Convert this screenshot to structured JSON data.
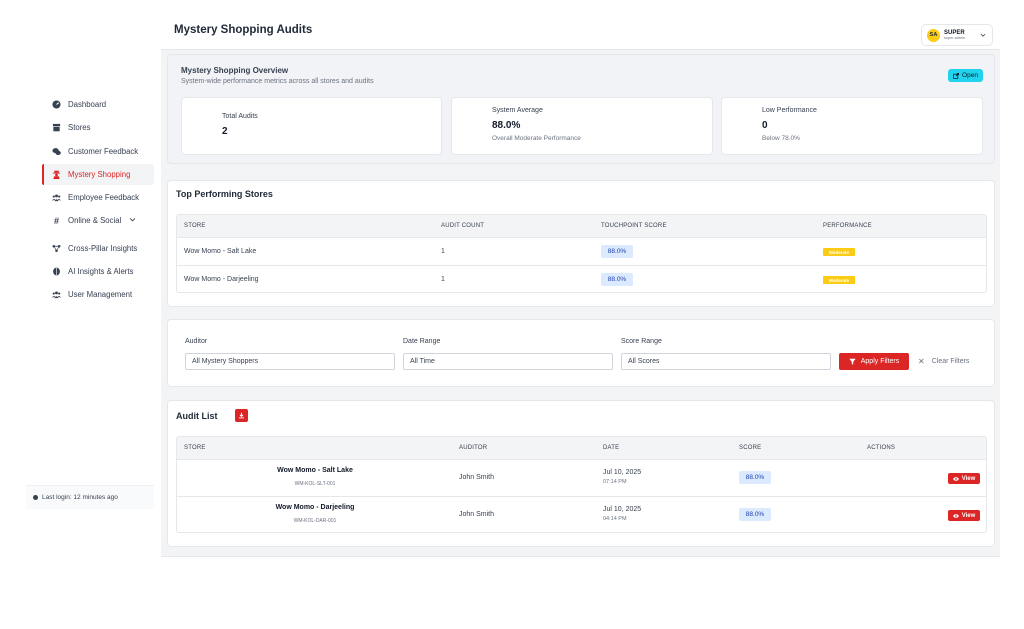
{
  "sidebar": {
    "items": [
      {
        "label": "Dashboard",
        "icon": "dashboard-icon"
      },
      {
        "label": "Stores",
        "icon": "store-icon"
      },
      {
        "label": "Customer Feedback",
        "icon": "chat-bubbles-icon"
      },
      {
        "label": "Mystery Shopping",
        "icon": "user-secret-icon",
        "active": true
      },
      {
        "label": "Employee Feedback",
        "icon": "users-icon"
      },
      {
        "label": "Online & Social",
        "icon": "hashtag-icon",
        "has_chevron": true
      },
      {
        "label": "Cross-Pillar Insights",
        "icon": "network-icon"
      },
      {
        "label": "AI Insights & Alerts",
        "icon": "brain-icon"
      },
      {
        "label": "User Management",
        "icon": "users-cog-icon"
      }
    ],
    "last_login": "Last login: 12 minutes ago"
  },
  "header": {
    "title": "Mystery Shopping Audits",
    "user": {
      "initials": "SA",
      "name": "SUPER",
      "role": "super-admin"
    }
  },
  "overview": {
    "title": "Mystery Shopping Overview",
    "subtitle": "System-wide performance metrics across all stores and audits",
    "open_label": "Open",
    "stats": [
      {
        "label": "Total Audits",
        "value": "2",
        "sub": ""
      },
      {
        "label": "System Average",
        "value": "88.0%",
        "sub": "Overall Moderate Performance"
      },
      {
        "label": "Low Performance",
        "value": "0",
        "sub": "Below 78.0%"
      }
    ]
  },
  "top_stores": {
    "title": "Top Performing Stores",
    "columns": [
      "STORE",
      "AUDIT COUNT",
      "TOUCHPOINT SCORE",
      "PERFORMANCE"
    ],
    "rows": [
      {
        "store": "Wow Momo - Salt Lake",
        "count": "1",
        "score": "88.0%",
        "performance": "Moderate"
      },
      {
        "store": "Wow Momo - Darjeeling",
        "count": "1",
        "score": "88.0%",
        "performance": "Moderate"
      }
    ]
  },
  "filters": {
    "auditor_label": "Auditor",
    "auditor_value": "All Mystery Shoppers",
    "date_label": "Date Range",
    "date_value": "All Time",
    "score_label": "Score Range",
    "score_value": "All Scores",
    "apply_label": "Apply Filters",
    "clear_label": "Clear Filters"
  },
  "audit_list": {
    "title": "Audit List",
    "columns": [
      "STORE",
      "AUDITOR",
      "DATE",
      "SCORE",
      "ACTIONS"
    ],
    "rows": [
      {
        "store": "Wow Momo - Salt Lake",
        "code": "WM-KOL-SLT-001",
        "auditor": "John Smith",
        "date": "Jul 10, 2025",
        "time": "07:14 PM",
        "score": "88.0%",
        "action": "View"
      },
      {
        "store": "Wow Momo - Darjeeling",
        "code": "WM-KOL-DAR-001",
        "auditor": "John Smith",
        "date": "Jul 10, 2025",
        "time": "04:14 PM",
        "score": "88.0%",
        "action": "View"
      }
    ]
  },
  "colors": {
    "accent": "#dc2626",
    "open": "#22d3ee",
    "score_bg": "#dbeafe",
    "badge": "#facc15"
  }
}
